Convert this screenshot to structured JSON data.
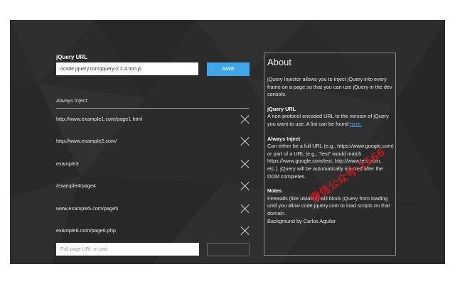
{
  "settings": {
    "jquery_url_label": "jQuery URL",
    "jquery_url_value": "//code.jquery.com/jquery-2.2.4.min.js",
    "save_label": "SAVE",
    "always_inject_label": "Always Inject",
    "inject_list": [
      "http://www.example1.com/page1.html",
      "http://www.example2.com/",
      "example3",
      "/example4/page4",
      "www.example5.com/page5",
      "example6.com/page6.php"
    ],
    "new_url_placeholder": "Full page URL or part",
    "add_label": ""
  },
  "about": {
    "title": "About",
    "intro": "jQuery Injector allows you to inject jQuery into every frame on a page so that you can use jQuery in the dev console.",
    "jquery_url_heading": "jQuery URL",
    "jquery_url_text": "A non-protocol encoded URL to the version of jQuery you want to use. A list can be found ",
    "jquery_url_link": "here.",
    "always_inject_heading": "Always Inject",
    "always_inject_text": "Can either be a full URL (e.g., https://www.google.com) or part of a URL (e.g., \"test\" would match https://www.google.com/test, http://www.test.com, etc.). jQuery will be automatically injected after the DOM completes.",
    "notes_heading": "Notes",
    "notes_text": "Firewalls (like uMatrix) will block jQuery from loading until you allow code.jquery.com to load scripts on that domain.",
    "credit": "Background by Carlos Aguilar"
  },
  "watermark": "微信公众号:1566",
  "colors": {
    "panel_bg": "#2b2b2b",
    "accent": "#3fa7e8",
    "watermark": "#c8191e"
  },
  "icons": {
    "remove": "close-icon"
  }
}
